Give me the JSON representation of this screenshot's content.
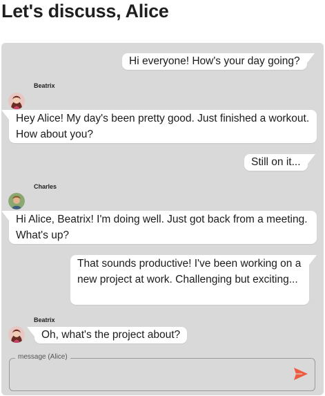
{
  "header": {
    "title": "Let's discuss, Alice"
  },
  "messages": [
    {
      "text": "Hi everyone! How's your day going?"
    },
    {
      "sender": "Beatrix",
      "text": "Hey Alice! My day's been pretty good. Just finished a workout. How about you?"
    },
    {
      "text": "Still on it..."
    },
    {
      "sender": "Charles",
      "text": "Hi Alice, Beatrix! I'm doing well. Just got back from a meeting. What's up?"
    },
    {
      "text": "That sounds productive! I've been working on a new project at work. Challenging but exciting..."
    },
    {
      "sender": "Beatrix",
      "text": "Oh, what's the project about?"
    }
  ],
  "composer": {
    "label": "message (Alice)",
    "value": "",
    "send_icon": "send-icon"
  },
  "colors": {
    "panel_bg": "#d9d9d9",
    "bubble_bg": "#ffffff",
    "send_accent": "#ef5b3f"
  }
}
